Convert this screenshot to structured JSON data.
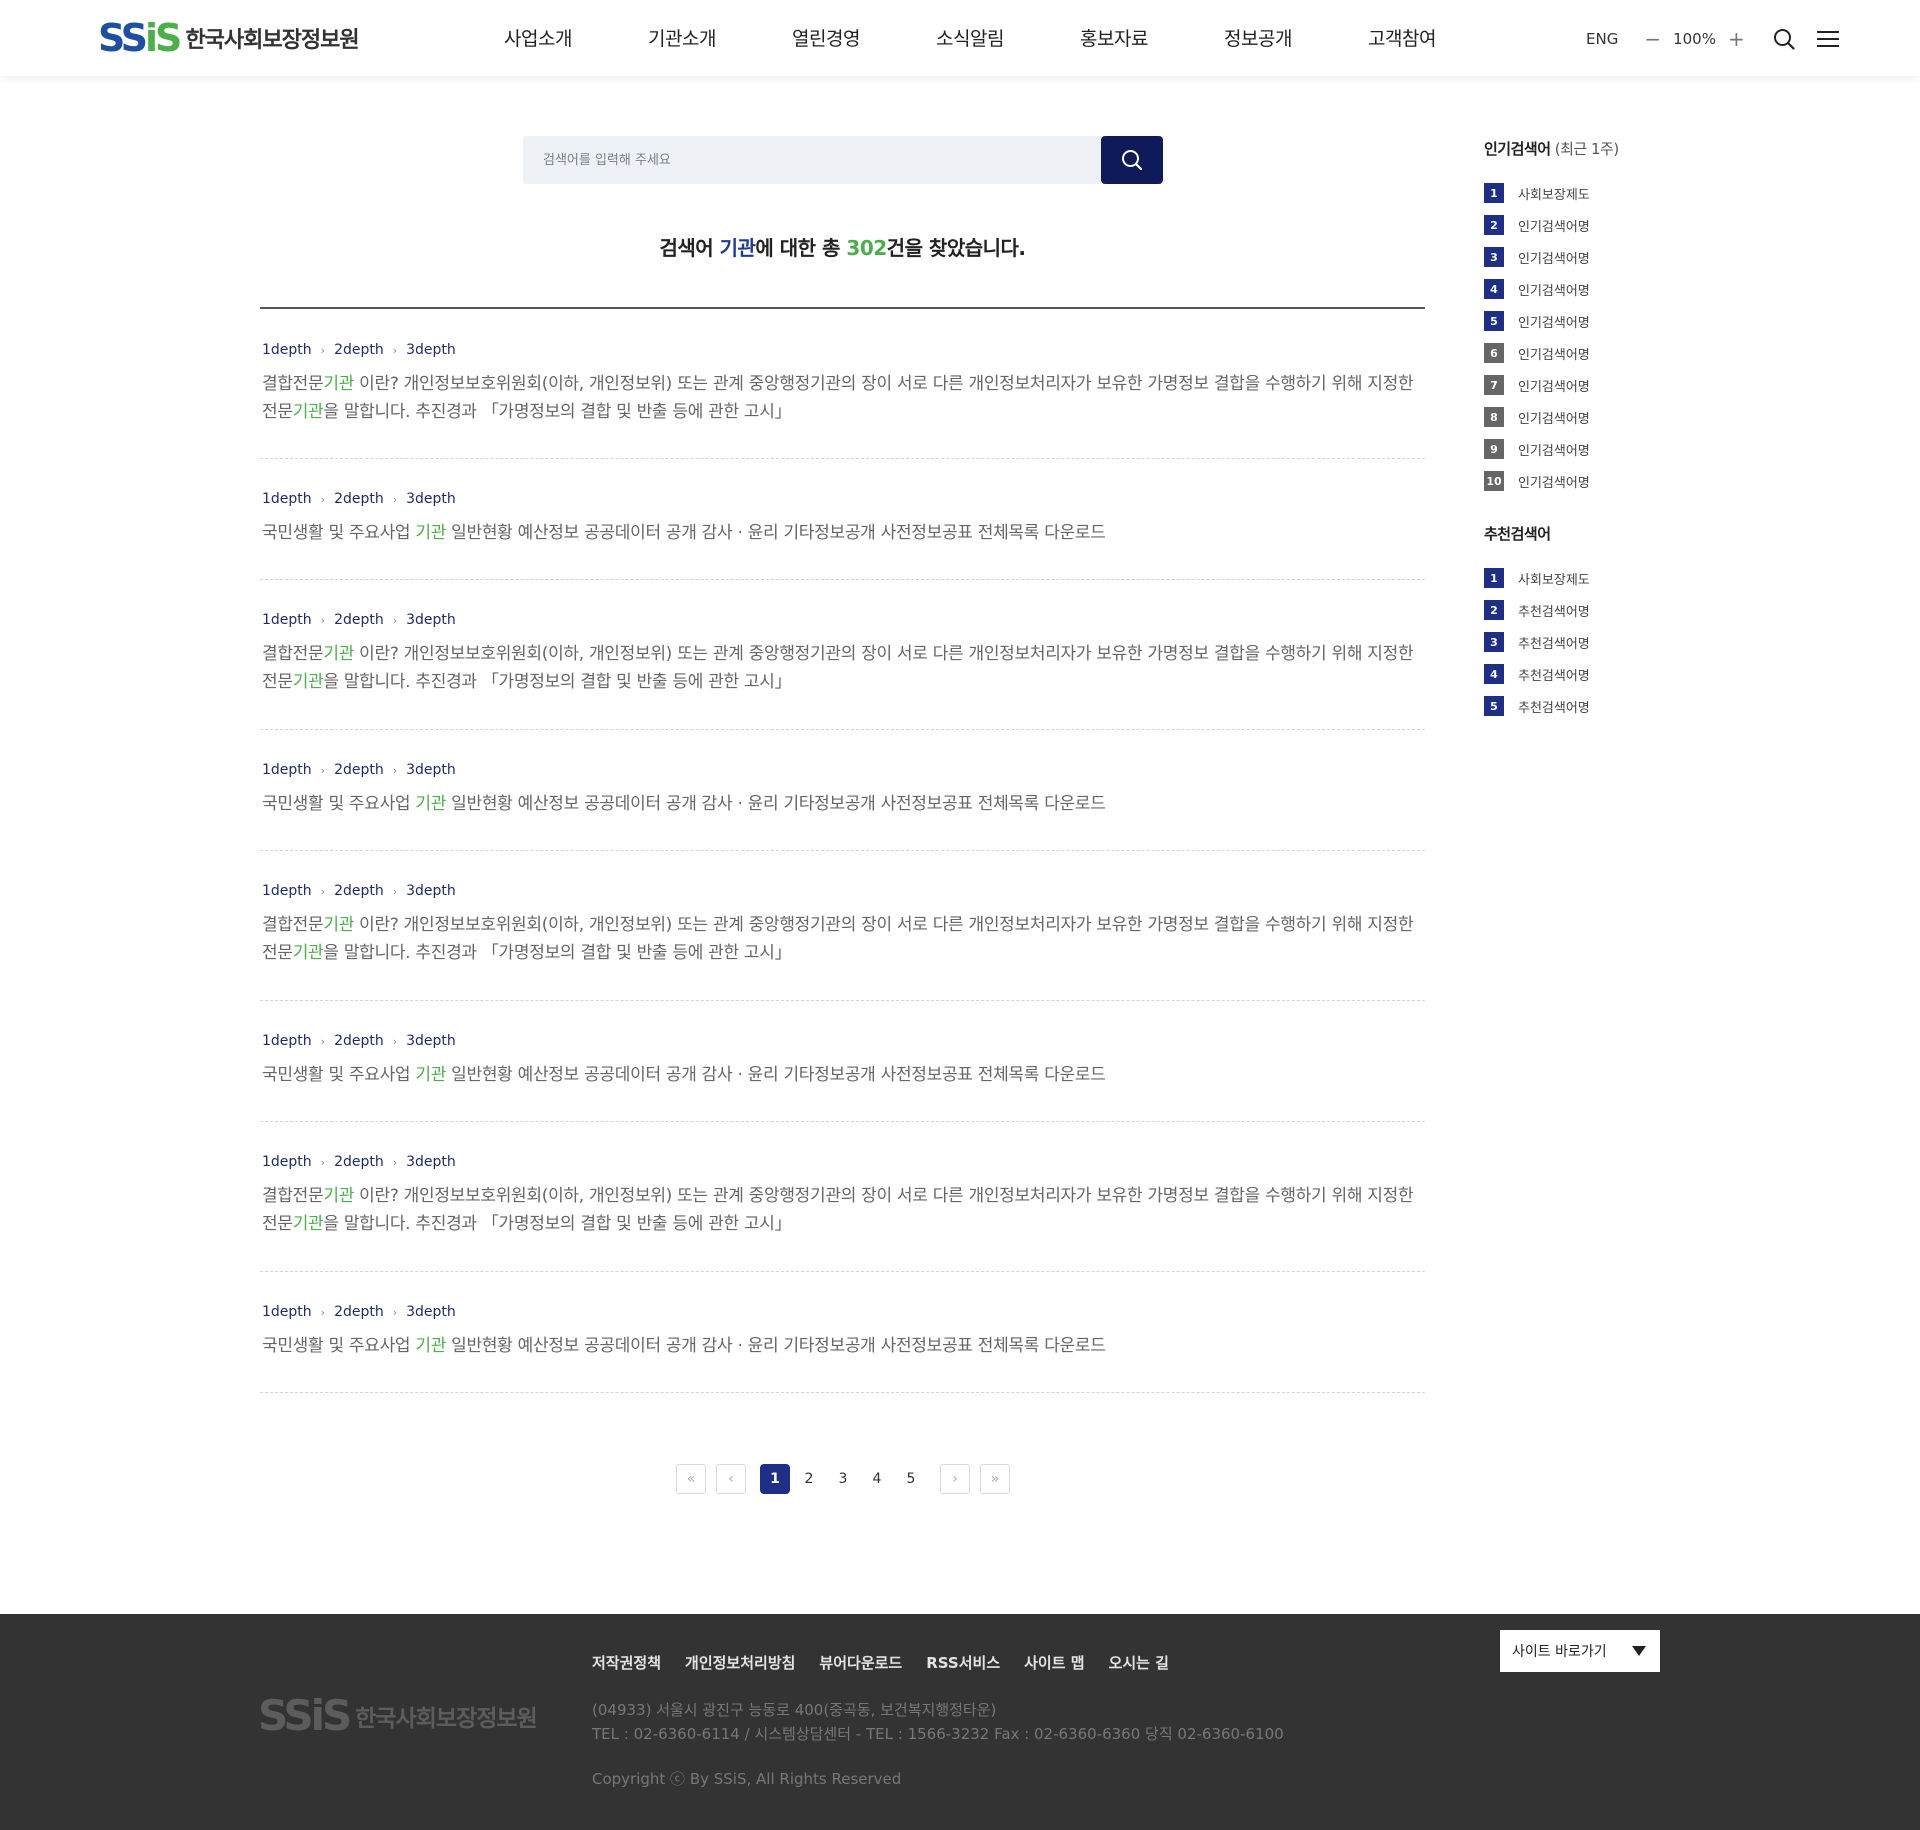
{
  "header": {
    "logo_mark": "SSiS",
    "logo_text": "한국사회보장정보원",
    "nav": [
      "사업소개",
      "기관소개",
      "열린경영",
      "소식알림",
      "홍보자료",
      "정보공개",
      "고객참여"
    ],
    "lang": "ENG",
    "zoom_minus": "−",
    "zoom_value": "100%",
    "zoom_plus": "+"
  },
  "search": {
    "placeholder": "검색어를 입력해 주세요"
  },
  "summary": {
    "prefix": "검색어 ",
    "keyword": "기관",
    "middle": "에 대한 총 ",
    "count": "302",
    "suffix": "건을 찾았습니다."
  },
  "results": [
    {
      "crumbs": [
        "1depth",
        "2depth",
        "3depth"
      ],
      "type": "long",
      "parts": [
        "결합전문",
        "기관",
        " 이란? 개인정보보호위원회(이하, 개인정보위) 또는 관계 중앙행정기관의 장이 서로 다른 개인정보처리자가 보유한 가명정보 결합을 수행하기 위해 지정한 전문",
        "기관",
        "을 말합니다. 추진경과 「가명정보의 결합 및 반출 등에 관한 고시」"
      ]
    },
    {
      "crumbs": [
        "1depth",
        "2depth",
        "3depth"
      ],
      "type": "short",
      "parts": [
        "국민생활 및 주요사업 ",
        "기관",
        " 일반현황 예산정보 공공데이터 공개 감사 · 윤리 기타정보공개 사전정보공표 전체목록 다운로드"
      ]
    },
    {
      "crumbs": [
        "1depth",
        "2depth",
        "3depth"
      ],
      "type": "long",
      "parts": [
        "결합전문",
        "기관",
        " 이란? 개인정보보호위원회(이하, 개인정보위) 또는 관계 중앙행정기관의 장이 서로 다른 개인정보처리자가 보유한 가명정보 결합을 수행하기 위해 지정한 전문",
        "기관",
        "을 말합니다. 추진경과 「가명정보의 결합 및 반출 등에 관한 고시」"
      ]
    },
    {
      "crumbs": [
        "1depth",
        "2depth",
        "3depth"
      ],
      "type": "short",
      "parts": [
        "국민생활 및 주요사업 ",
        "기관",
        " 일반현황 예산정보 공공데이터 공개 감사 · 윤리 기타정보공개 사전정보공표 전체목록 다운로드"
      ]
    },
    {
      "crumbs": [
        "1depth",
        "2depth",
        "3depth"
      ],
      "type": "long",
      "parts": [
        "결합전문",
        "기관",
        " 이란? 개인정보보호위원회(이하, 개인정보위) 또는 관계 중앙행정기관의 장이 서로 다른 개인정보처리자가 보유한 가명정보 결합을 수행하기 위해 지정한 전문",
        "기관",
        "을 말합니다. 추진경과 「가명정보의 결합 및 반출 등에 관한 고시」"
      ]
    },
    {
      "crumbs": [
        "1depth",
        "2depth",
        "3depth"
      ],
      "type": "short",
      "parts": [
        "국민생활 및 주요사업 ",
        "기관",
        " 일반현황 예산정보 공공데이터 공개 감사 · 윤리 기타정보공개 사전정보공표 전체목록 다운로드"
      ]
    },
    {
      "crumbs": [
        "1depth",
        "2depth",
        "3depth"
      ],
      "type": "long",
      "parts": [
        "결합전문",
        "기관",
        " 이란? 개인정보보호위원회(이하, 개인정보위) 또는 관계 중앙행정기관의 장이 서로 다른 개인정보처리자가 보유한 가명정보 결합을 수행하기 위해 지정한 전문",
        "기관",
        "을 말합니다. 추진경과 「가명정보의 결합 및 반출 등에 관한 고시」"
      ]
    },
    {
      "crumbs": [
        "1depth",
        "2depth",
        "3depth"
      ],
      "type": "short",
      "parts": [
        "국민생활 및 주요사업 ",
        "기관",
        " 일반현황 예산정보 공공데이터 공개 감사 · 윤리 기타정보공개 사전정보공표 전체목록 다운로드"
      ]
    }
  ],
  "sidebar": {
    "popular_title": "인기검색어",
    "popular_sub": " (최근 1주)",
    "popular": [
      "사회보장제도",
      "인기검색어명",
      "인기검색어명",
      "인기검색어명",
      "인기검색어명",
      "인기검색어명",
      "인기검색어명",
      "인기검색어명",
      "인기검색어명",
      "인기검색어명"
    ],
    "recommend_title": "추천검색어",
    "recommend": [
      "사회보장제도",
      "추천검색어명",
      "추천검색어명",
      "추천검색어명",
      "추천검색어명"
    ],
    "colors": {
      "top": "#1f2f88",
      "rest": "#666666"
    }
  },
  "pagination": {
    "first": "«",
    "prev": "‹",
    "pages": [
      "1",
      "2",
      "3",
      "4",
      "5"
    ],
    "current": "1",
    "next": "›",
    "last": "»"
  },
  "footer": {
    "links": [
      "저작권정책",
      "개인정보처리방침",
      "뷰어다운로드",
      "RSS서비스",
      "사이트 맵",
      "오시는 길"
    ],
    "logo_mark": "SSiS",
    "logo_text": "한국사회보장정보원",
    "address": "(04933) 서울시 광진구 능동로 400(중곡동, 보건복지행정타운)",
    "phone": "TEL : 02-6360-6114 / 시스템상담센터 - TEL : 1566-3232  Fax : 02-6360-6360  당직 02-6360-6100",
    "copyright": "Copyright ⓒ By SSiS, All Rights Reserved",
    "site_select": "사이트 바로가기"
  },
  "colors": {
    "brand_blue": "#1f4fa0",
    "brand_green": "#4bb04a",
    "navy": "#0f1a5a",
    "footer_bg": "#333333"
  }
}
